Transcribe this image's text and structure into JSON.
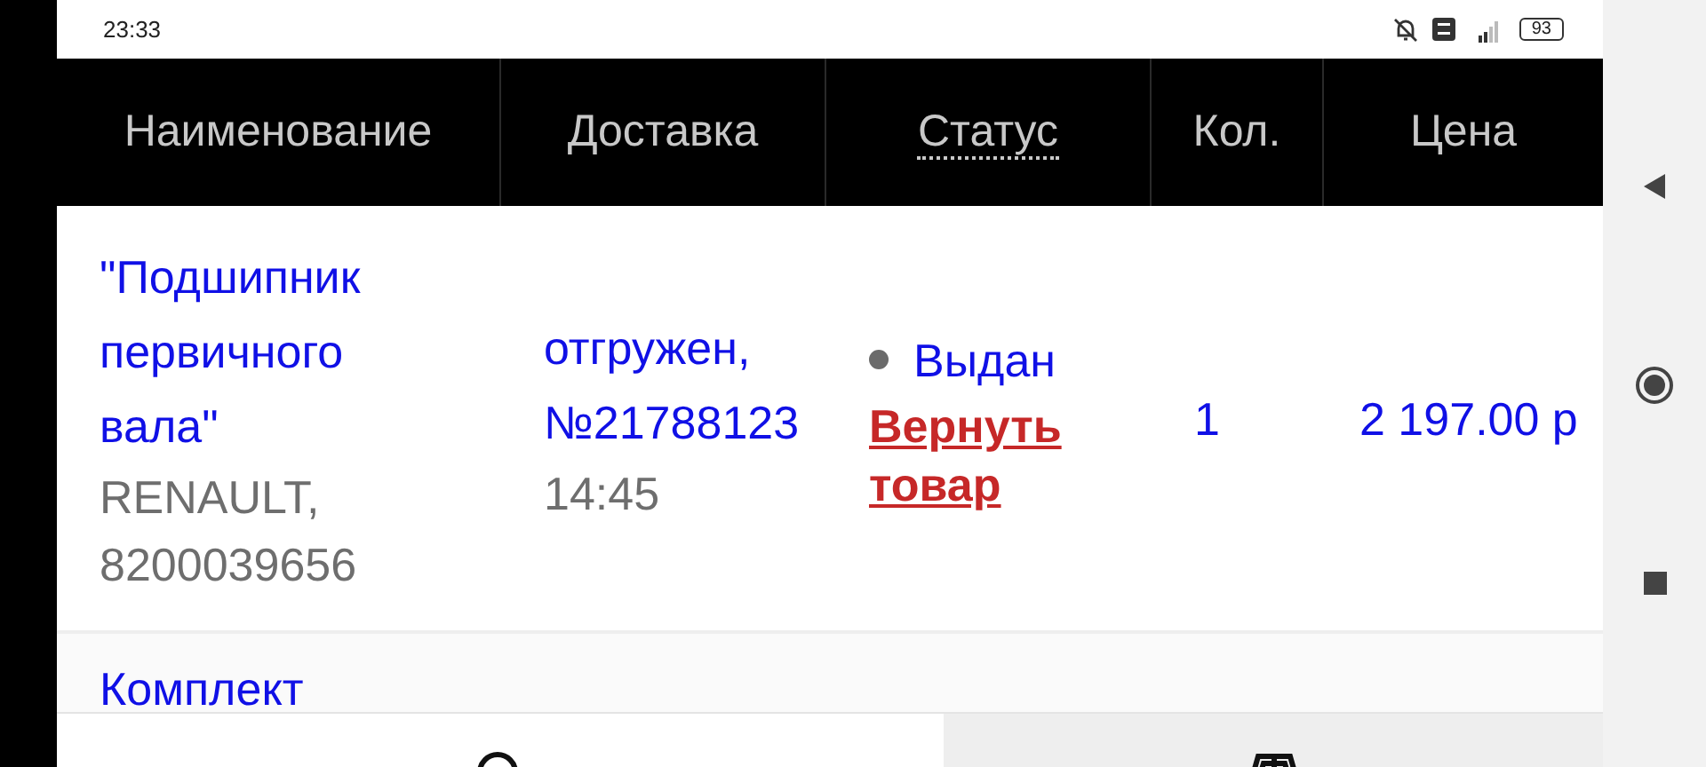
{
  "status_bar": {
    "time": "23:33",
    "battery": "93"
  },
  "table": {
    "columns": [
      {
        "label": "Наименование",
        "kind": "plain"
      },
      {
        "label": "Доставка",
        "kind": "plain"
      },
      {
        "label": "Статус",
        "kind": "dotted"
      },
      {
        "label": "Кол.",
        "kind": "plain"
      },
      {
        "label": "Цена",
        "kind": "plain"
      }
    ],
    "rows": [
      {
        "name": "\"Подшипник первичного вала\"",
        "brand": "RENAULT, 8200039656",
        "delivery": "отгружен, №21788123",
        "delivery_time": "14:45",
        "status": "Выдан",
        "color": "#6b6b6b",
        "action": "Вернуть товар",
        "quantity": "1",
        "price": "2 197.00 р"
      },
      {
        "name": "Комплект"
      }
    ]
  },
  "bottom_nav": [
    {
      "kind": "search",
      "selected": false
    },
    {
      "kind": "car",
      "selected": true
    }
  ]
}
